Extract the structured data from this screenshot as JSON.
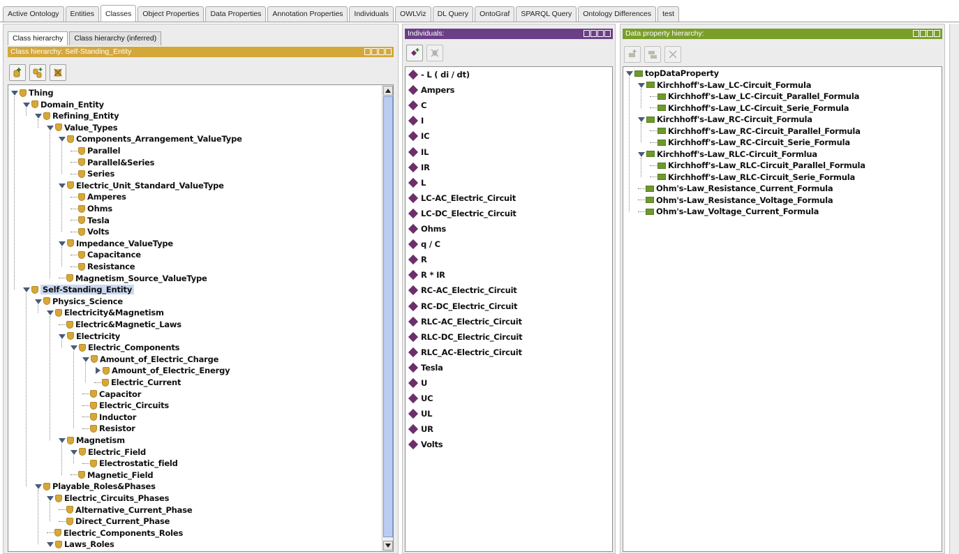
{
  "top_tabs": [
    "Active Ontology",
    "Entities",
    "Classes",
    "Object Properties",
    "Data Properties",
    "Annotation Properties",
    "Individuals",
    "OWLViz",
    "DL Query",
    "OntoGraf",
    "SPARQL Query",
    "Ontology Differences",
    "test"
  ],
  "active_tab": "Classes",
  "class_panel": {
    "subtabs": [
      "Class hierarchy",
      "Class hierarchy (inferred)"
    ],
    "header": "Class hierarchy: Self-Standing_Entity",
    "tree": [
      {
        "label": "Thing",
        "depth": 0,
        "expanded": true
      },
      {
        "label": "Domain_Entity",
        "depth": 1,
        "expanded": true
      },
      {
        "label": "Refining_Entity",
        "depth": 2,
        "expanded": true
      },
      {
        "label": "Value_Types",
        "depth": 3,
        "expanded": true
      },
      {
        "label": "Components_Arrangement_ValueType",
        "depth": 4,
        "expanded": true
      },
      {
        "label": "Parallel",
        "depth": 5
      },
      {
        "label": "Parallel&Series",
        "depth": 5
      },
      {
        "label": "Series",
        "depth": 5
      },
      {
        "label": "Electric_Unit_Standard_ValueType",
        "depth": 4,
        "expanded": true
      },
      {
        "label": "Amperes",
        "depth": 5
      },
      {
        "label": "Ohms",
        "depth": 5
      },
      {
        "label": "Tesla",
        "depth": 5
      },
      {
        "label": "Volts",
        "depth": 5
      },
      {
        "label": "Impedance_ValueType",
        "depth": 4,
        "expanded": true
      },
      {
        "label": "Capacitance",
        "depth": 5
      },
      {
        "label": "Resistance",
        "depth": 5
      },
      {
        "label": "Magnetism_Source_ValueType",
        "depth": 4
      },
      {
        "label": "Self-Standing_Entity",
        "depth": 1,
        "expanded": true,
        "selected": true
      },
      {
        "label": "Physics_Science",
        "depth": 2,
        "expanded": true
      },
      {
        "label": "Electricity&Magnetism",
        "depth": 3,
        "expanded": true
      },
      {
        "label": "Electric&Magnetic_Laws",
        "depth": 4
      },
      {
        "label": "Electricity",
        "depth": 4,
        "expanded": true
      },
      {
        "label": "Electric_Components",
        "depth": 5,
        "expanded": true
      },
      {
        "label": "Amount_of_Electric_Charge",
        "depth": 6,
        "expanded": true
      },
      {
        "label": "Amount_of_Electric_Energy",
        "depth": 7,
        "collapsed": true
      },
      {
        "label": "Electric_Current",
        "depth": 7
      },
      {
        "label": "Capacitor",
        "depth": 6
      },
      {
        "label": "Electric_Circuits",
        "depth": 6
      },
      {
        "label": "Inductor",
        "depth": 6
      },
      {
        "label": "Resistor",
        "depth": 6
      },
      {
        "label": "Magnetism",
        "depth": 4,
        "expanded": true
      },
      {
        "label": "Electric_Field",
        "depth": 5,
        "expanded": true
      },
      {
        "label": "Electrostatic_field",
        "depth": 6
      },
      {
        "label": "Magnetic_Field",
        "depth": 5
      },
      {
        "label": "Playable_Roles&Phases",
        "depth": 2,
        "expanded": true
      },
      {
        "label": "Electric_Circuits_Phases",
        "depth": 3,
        "expanded": true
      },
      {
        "label": "Alternative_Current_Phase",
        "depth": 4
      },
      {
        "label": "Direct_Current_Phase",
        "depth": 4
      },
      {
        "label": "Electric_Components_Roles",
        "depth": 3
      },
      {
        "label": "Laws_Roles",
        "depth": 3,
        "expanded": true
      }
    ]
  },
  "individuals_panel": {
    "header": "Individuals:",
    "items": [
      "- L ( di / dt)",
      "Ampers",
      "C",
      "I",
      "IC",
      "IL",
      "IR",
      "L",
      "LC-AC_Electric_Circuit",
      "LC-DC_Electric_Circuit",
      "Ohms",
      "q / C",
      "R",
      "R * IR",
      "RC-AC_Electric_Circuit",
      "RC-DC_Electric_Circuit",
      "RLC-AC_Electric_Circuit",
      "RLC-DC_Electric_Circuit",
      "RLC_AC-Electric_Circuit",
      "Tesla",
      "U",
      "UC",
      "UL",
      "UR",
      "Volts"
    ]
  },
  "data_property_panel": {
    "header": "Data property hierarchy:",
    "tree": [
      {
        "label": "topDataProperty",
        "depth": 0,
        "expanded": true
      },
      {
        "label": "Kirchhoff's-Law_LC-Circuit_Formula",
        "depth": 1,
        "expanded": true
      },
      {
        "label": "Kirchhoff's-Law_LC-Circuit_Parallel_Formula",
        "depth": 2
      },
      {
        "label": "Kirchhoff's-Law_LC-Circuit_Serie_Formula",
        "depth": 2
      },
      {
        "label": "Kirchhoff's-Law_RC-Circuit_Formula",
        "depth": 1,
        "expanded": true
      },
      {
        "label": "Kirchhoff's-Law_RC-Circuit_Parallel_Formula",
        "depth": 2
      },
      {
        "label": "Kirchhoff's-Law_RC-Circuit_Serie_Formula",
        "depth": 2
      },
      {
        "label": "Kirchhoff's-Law_RLC-Circuit_Formlua",
        "depth": 1,
        "expanded": true
      },
      {
        "label": "Kirchhoff's-Law_RLC-Circuit_Parallel_Formula",
        "depth": 2
      },
      {
        "label": "Kirchhoff's-Law_RLC-Circuit_Serie_Formula",
        "depth": 2
      },
      {
        "label": "Ohm's-Law_Resistance_Current_Formula",
        "depth": 1
      },
      {
        "label": "Ohm's-Law_Resistance_Voltage_Formula",
        "depth": 1
      },
      {
        "label": "Ohm's-Law_Voltage_Current_Formula",
        "depth": 1
      }
    ]
  },
  "colors": {
    "class_header": "#d4a73b",
    "individuals_header": "#6b3f86",
    "data_property_header": "#7a9e2a",
    "selection": "#c9d9f3"
  },
  "icons": {
    "class": "class-icon",
    "individual": "individual-diamond-icon",
    "data_property": "data-property-icon"
  }
}
